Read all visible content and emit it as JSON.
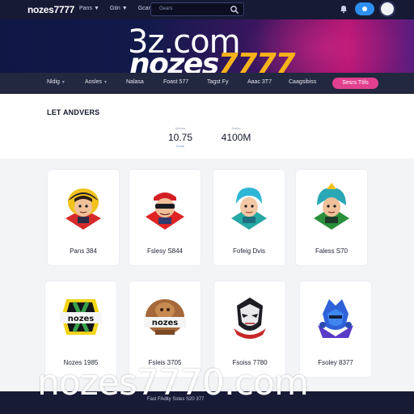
{
  "topbar": {
    "brand": "nozes7777",
    "nav": [
      {
        "label": "Pans",
        "has_caret": true
      },
      {
        "label": "Gtin",
        "has_caret": true
      },
      {
        "label": "Gcan",
        "has_caret": true
      }
    ],
    "search_placeholder": "Gears"
  },
  "hero": {
    "watermark": "3z.com",
    "logo_text": "nozes",
    "logo_number": "7777"
  },
  "catnav": {
    "items": [
      {
        "label": "Nldig",
        "has_caret": true
      },
      {
        "label": "Aosles",
        "has_caret": true
      },
      {
        "label": "Nalasa",
        "has_caret": false
      },
      {
        "label": "Foast 577",
        "has_caret": false
      },
      {
        "label": "Tagst Fy",
        "has_caret": false
      },
      {
        "label": "Aaac 3T7",
        "has_caret": false
      },
      {
        "label": "Caagsibiss",
        "has_caret": false
      }
    ],
    "cta_label": "Sesrs Ttils"
  },
  "stats": {
    "title": "LET ANDVERS",
    "items": [
      {
        "caption": "Anlieas",
        "value": "10.75",
        "sub": "Scoie"
      },
      {
        "caption": "Jtalise",
        "value": "4100M",
        "sub": ""
      }
    ]
  },
  "cards": [
    {
      "label": "Pans 384",
      "icon": "yellow-helmet-hero-icon"
    },
    {
      "label": "Fslesy S844",
      "icon": "red-cap-shades-hero-icon"
    },
    {
      "label": "Fofeig Dvis",
      "icon": "teal-hair-hero-icon"
    },
    {
      "label": "Faless S70",
      "icon": "green-hood-hero-icon"
    },
    {
      "label": "Nozes 1985",
      "icon": "nozes-badge-icon"
    },
    {
      "label": "Fsleis 3705",
      "icon": "nozes-bronze-badge-icon"
    },
    {
      "label": "Fsoiss 7780",
      "icon": "masked-villain-icon"
    },
    {
      "label": "Fsoley 8377",
      "icon": "blue-armor-hero-icon"
    }
  ],
  "footer": {
    "links": "Fasl  FAdlty Sstes     S20 377"
  },
  "watermark_bottom": "nozes7770.com"
}
